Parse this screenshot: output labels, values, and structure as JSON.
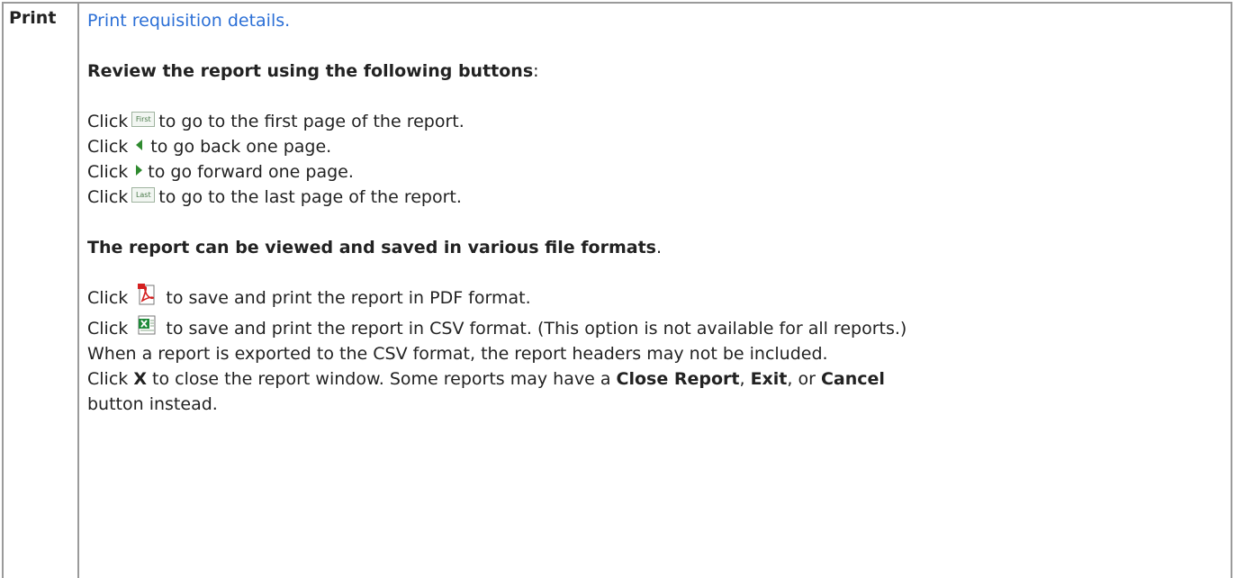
{
  "row_label": "Print",
  "link_text": "Print requisition details.",
  "review_heading": "Review the report using the following buttons",
  "review_heading_suffix": ":",
  "click": "Click",
  "nav_items": [
    {
      "icon": "first-page-icon",
      "icon_text": "First",
      "text": "to go to the first page of the report."
    },
    {
      "icon": "previous-page-icon",
      "text": "to go back one page."
    },
    {
      "icon": "next-page-icon",
      "text": "to go forward one page."
    },
    {
      "icon": "last-page-icon",
      "icon_text": "Last",
      "text": "to go to the last page of the report."
    }
  ],
  "formats_heading": "The report can be viewed and saved in various file formats",
  "formats_heading_suffix": ".",
  "pdf_text": "to save and print the report in PDF format.",
  "csv_text": "to save and print the report in CSV format. (This option is not available for all reports.)",
  "csv_note": "When a report is exported to the CSV format, the report headers may not be included.",
  "close": {
    "x": "X",
    "text1": "to close the report window. Some reports may have a",
    "close_report": "Close Report",
    "comma1": ",",
    "exit": "Exit",
    "or": ", or",
    "cancel": "Cancel",
    "text2": "button instead."
  },
  "colors": {
    "link": "#2b6fd6",
    "border": "#9a9a9a",
    "arrow": "#2f8a2f"
  }
}
